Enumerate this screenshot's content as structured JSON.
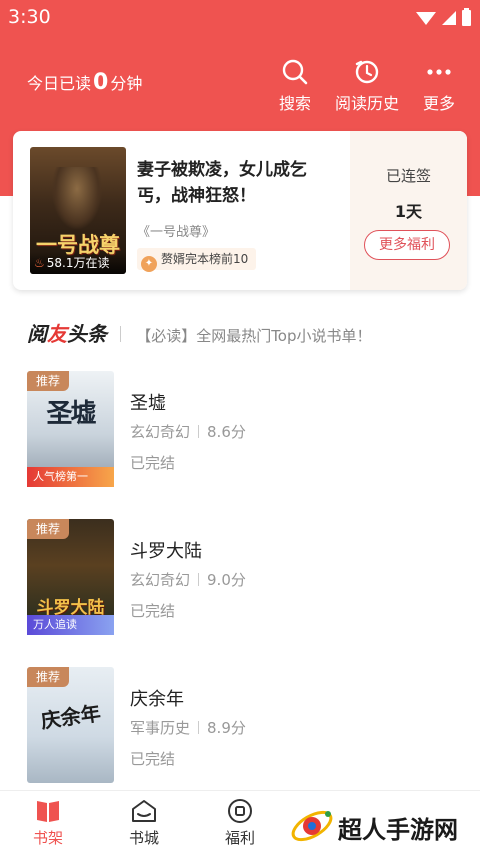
{
  "status_bar": {
    "time": "3:30"
  },
  "header": {
    "read_prefix": "今日已读",
    "read_minutes": "0",
    "read_suffix": "分钟",
    "actions": [
      {
        "label": "搜索",
        "icon": "search-icon"
      },
      {
        "label": "阅读历史",
        "icon": "history-icon"
      },
      {
        "label": "更多",
        "icon": "more-icon"
      }
    ]
  },
  "featured": {
    "cover_title": "一号战尊",
    "readers": "58.1万在读",
    "title": "妻子被欺凌，女儿成乞丐，战神狂怒！",
    "book": "《一号战尊》",
    "rank": "赘婿完本榜前10",
    "checkin_label": "已连签",
    "checkin_days": "1天",
    "more_benefits": "更多福利"
  },
  "news": {
    "brand_part1": "阅",
    "brand_part2": "友",
    "brand_part3": "头条",
    "headline": "【必读】全网最热门Top小说书单！"
  },
  "books": [
    {
      "tag": "推荐",
      "cover_text": "圣墟",
      "ribbon": "人气榜第一",
      "name": "圣墟",
      "genre": "玄幻奇幻",
      "score": "8.6分",
      "status": "已完结"
    },
    {
      "tag": "推荐",
      "cover_text": "斗罗大陆",
      "ribbon": "万人追读",
      "name": "斗罗大陆",
      "genre": "玄幻奇幻",
      "score": "9.0分",
      "status": "已完结"
    },
    {
      "tag": "推荐",
      "cover_text": "庆余年",
      "ribbon": "",
      "name": "庆余年",
      "genre": "军事历史",
      "score": "8.9分",
      "status": "已完结"
    }
  ],
  "bottom_nav": [
    {
      "label": "书架",
      "icon": "bookshelf-icon",
      "active": true
    },
    {
      "label": "书城",
      "icon": "bookstore-icon",
      "active": false
    },
    {
      "label": "福利",
      "icon": "benefits-icon",
      "active": false
    }
  ],
  "watermark": {
    "text": "超人手游网"
  },
  "colors": {
    "accent": "#ef5350",
    "tag": "#c8875b",
    "muted": "#999999"
  }
}
